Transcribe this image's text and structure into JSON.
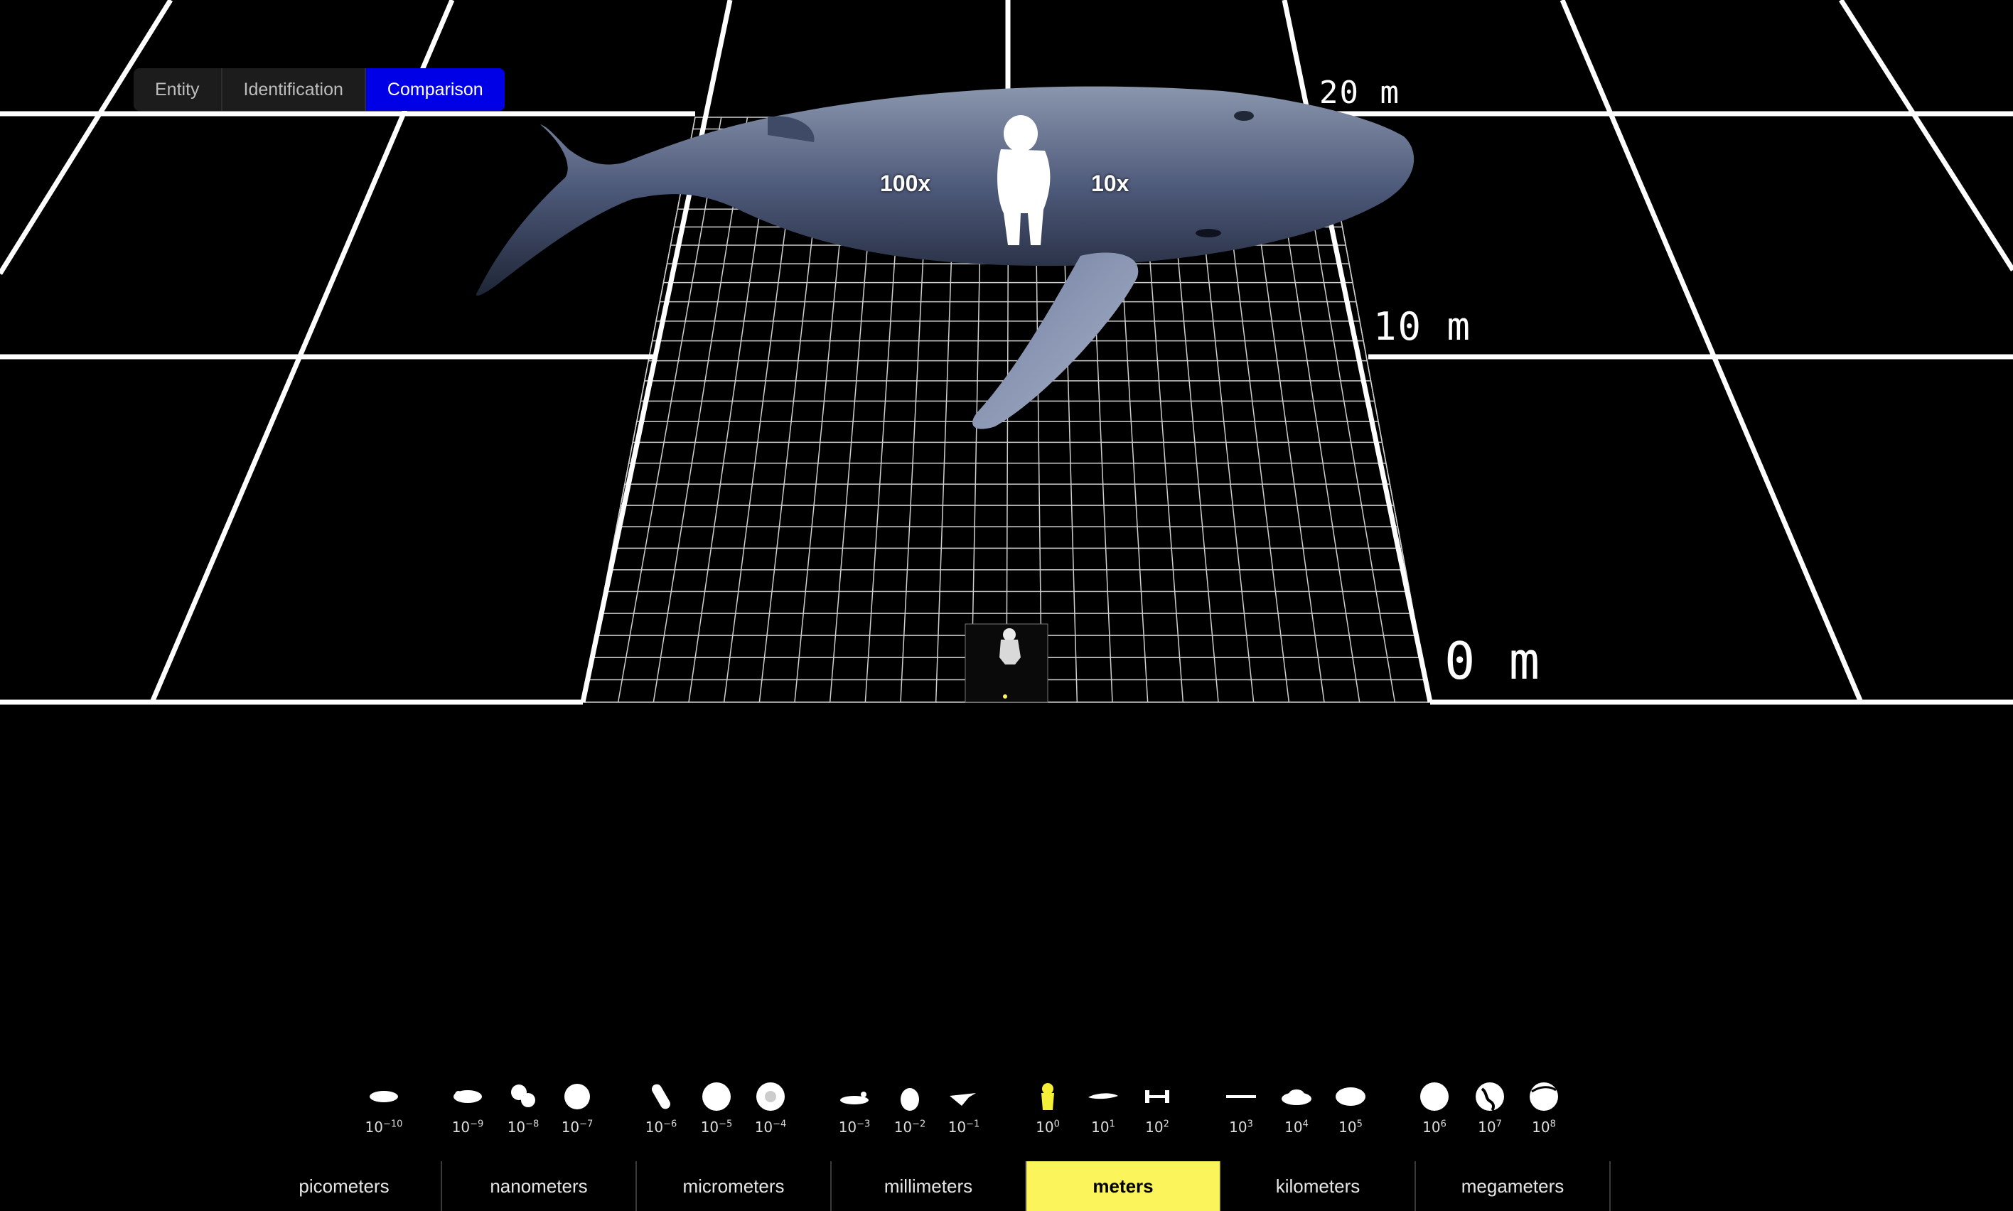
{
  "tabs": [
    {
      "label": "Entity",
      "active": false
    },
    {
      "label": "Identification",
      "active": false
    },
    {
      "label": "Comparison",
      "active": true
    }
  ],
  "grid_labels": {
    "top": "20 m",
    "middle": "10 m",
    "bottom": "0 m"
  },
  "comparison_labels": {
    "left": "100x",
    "right": "10x"
  },
  "scale_icons": [
    {
      "exp": "-10",
      "icon": "atom-icon"
    },
    {
      "exp": "-9",
      "icon": "molecule-icon"
    },
    {
      "exp": "-8",
      "icon": "virus-cluster-icon"
    },
    {
      "exp": "-7",
      "icon": "virus-icon"
    },
    {
      "exp": "-6",
      "icon": "bacterium-icon"
    },
    {
      "exp": "-5",
      "icon": "cell-icon"
    },
    {
      "exp": "-4",
      "icon": "egg-cell-icon"
    },
    {
      "exp": "-3",
      "icon": "ant-icon"
    },
    {
      "exp": "-2",
      "icon": "acorn-icon"
    },
    {
      "exp": "-1",
      "icon": "hummingbird-icon"
    },
    {
      "exp": "0",
      "icon": "astronaut-icon",
      "active": true
    },
    {
      "exp": "1",
      "icon": "whale-icon"
    },
    {
      "exp": "2",
      "icon": "space-station-icon"
    },
    {
      "exp": "3",
      "icon": "airship-icon"
    },
    {
      "exp": "4",
      "icon": "city-icon"
    },
    {
      "exp": "5",
      "icon": "island-icon"
    },
    {
      "exp": "6",
      "icon": "moon-icon"
    },
    {
      "exp": "7",
      "icon": "earth-icon"
    },
    {
      "exp": "8",
      "icon": "planet-icon"
    }
  ],
  "scale_base": "10",
  "units": [
    {
      "label": "picometers",
      "active": false
    },
    {
      "label": "nanometers",
      "active": false
    },
    {
      "label": "micrometers",
      "active": false
    },
    {
      "label": "millimeters",
      "active": false
    },
    {
      "label": "meters",
      "active": true
    },
    {
      "label": "kilometers",
      "active": false
    },
    {
      "label": "megameters",
      "active": false
    }
  ],
  "colors": {
    "accent": "#0000e6",
    "unit_highlight": "#fbf55b",
    "active_icon": "#f6ef3a",
    "grid": "#ffffff",
    "background": "#000000"
  }
}
